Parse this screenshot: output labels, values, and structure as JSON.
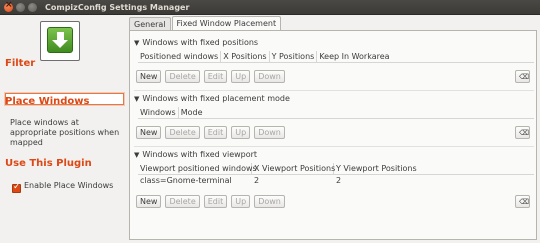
{
  "window": {
    "title": "CompizConfig Settings Manager"
  },
  "sidebar": {
    "filter_heading": "Filter",
    "filter_value": "",
    "place_heading": "Place Windows",
    "description": "Place windows at appropriate positions when mapped",
    "use_heading": "Use This Plugin",
    "enable_label": "Enable Place Windows",
    "enable_checked": true
  },
  "tabs": [
    {
      "label": "General",
      "active": false
    },
    {
      "label": "Fixed Window Placement",
      "active": true
    }
  ],
  "sections": {
    "fixed_positions": {
      "title": "Windows with fixed positions",
      "columns": [
        "Positioned windows",
        "X Positions",
        "Y Positions",
        "Keep In Workarea"
      ]
    },
    "fixed_mode": {
      "title": "Windows with fixed placement mode",
      "columns": [
        "Windows",
        "Mode"
      ]
    },
    "fixed_viewport": {
      "title": "Windows with fixed viewport",
      "columns": [
        "Viewport positioned windows",
        "X Viewport Positions",
        "Y Viewport Positions"
      ],
      "rows": [
        [
          "class=Gnome-terminal",
          "2",
          "2"
        ]
      ]
    }
  },
  "buttons": {
    "new": "New",
    "delete": "Delete",
    "edit": "Edit",
    "up": "Up",
    "down": "Down"
  },
  "icons": {
    "back": "back-arrow-icon",
    "clear": "clear-icon",
    "expander": "triangle-down-icon"
  },
  "colors": {
    "accent": "#dd4814",
    "titlebar": "#3c3b37",
    "back_arrow": "#4fa22e"
  }
}
